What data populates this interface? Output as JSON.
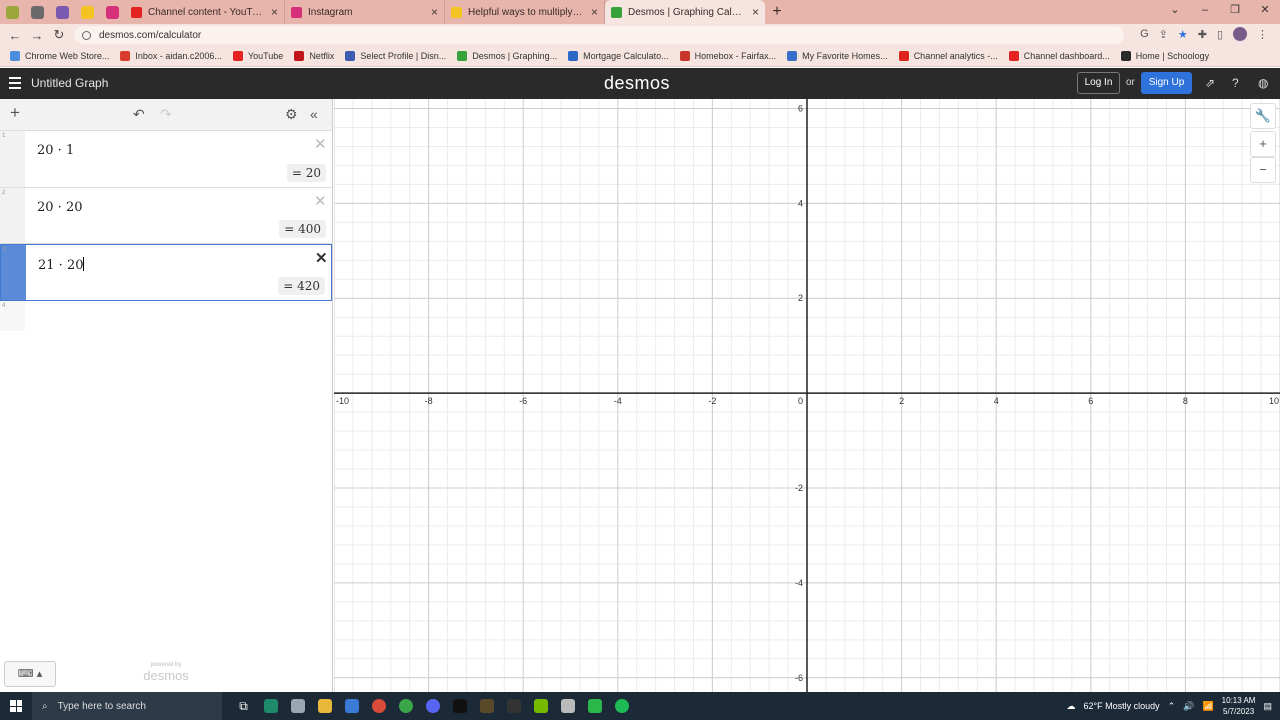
{
  "browser": {
    "tabs": [
      {
        "title": "Channel content - YouTube Studio",
        "favicon_color": "#e3231f",
        "active": false
      },
      {
        "title": "Instagram",
        "favicon_color": "#d6307a",
        "active": false
      },
      {
        "title": "Helpful ways to multiply double digit",
        "favicon_color": "#f3c324",
        "active": false
      },
      {
        "title": "Desmos | Graphing Calculator",
        "favicon_color": "#37a23a",
        "active": true
      }
    ],
    "pinned_tab_colors": [
      "#9aa63a",
      "#6a6a6a",
      "#7a5ab0",
      "#f3c324",
      "#d6307a"
    ],
    "url": "desmos.com/calculator",
    "bookmarks": [
      {
        "label": "Chrome Web Store...",
        "color": "#4a8ee0"
      },
      {
        "label": "Inbox - aidan.c2006...",
        "color": "#d93a2a"
      },
      {
        "label": "YouTube",
        "color": "#e3231f"
      },
      {
        "label": "Netflix",
        "color": "#c2121a"
      },
      {
        "label": "Select Profile | Disn...",
        "color": "#3e5bb0"
      },
      {
        "label": "Desmos | Graphing...",
        "color": "#37a23a"
      },
      {
        "label": "Mortgage Calculato...",
        "color": "#2a66c8"
      },
      {
        "label": "Homebox - Fairfax...",
        "color": "#c8362a"
      },
      {
        "label": "My Favorite Homes...",
        "color": "#3b6ec8"
      },
      {
        "label": "Channel analytics -...",
        "color": "#e3231f"
      },
      {
        "label": "Channel dashboard...",
        "color": "#e3231f"
      },
      {
        "label": "Home | Schoology",
        "color": "#2a2a2a"
      }
    ]
  },
  "header": {
    "title": "Untitled Graph",
    "brand": "desmos",
    "login_label": "Log In",
    "or_label": "or",
    "signup_label": "Sign Up"
  },
  "expressions": [
    {
      "index": "1",
      "latex": "20 · 1",
      "result": "= 20",
      "selected": false
    },
    {
      "index": "2",
      "latex": "20 · 20",
      "result": "= 400",
      "selected": false
    },
    {
      "index": "3",
      "latex": "21 · 20",
      "result": "= 420",
      "selected": true
    }
  ],
  "empty_row_index": "4",
  "powered_by": {
    "line1": "powered by",
    "line2": "desmos"
  },
  "graph": {
    "x_range": [
      -10,
      10
    ],
    "y_range": [
      -6.3,
      6.2
    ],
    "x_ticks": [
      "-10",
      "-8",
      "-6",
      "-4",
      "-2",
      "0",
      "2",
      "4",
      "6",
      "8",
      "10"
    ],
    "y_ticks": [
      "6",
      "4",
      "2",
      "-2",
      "-4",
      "-6"
    ]
  },
  "taskbar": {
    "search_placeholder": "Type here to search",
    "weather": "62°F  Mostly cloudy",
    "time": "10:13 AM",
    "date": "5/7/2023"
  }
}
